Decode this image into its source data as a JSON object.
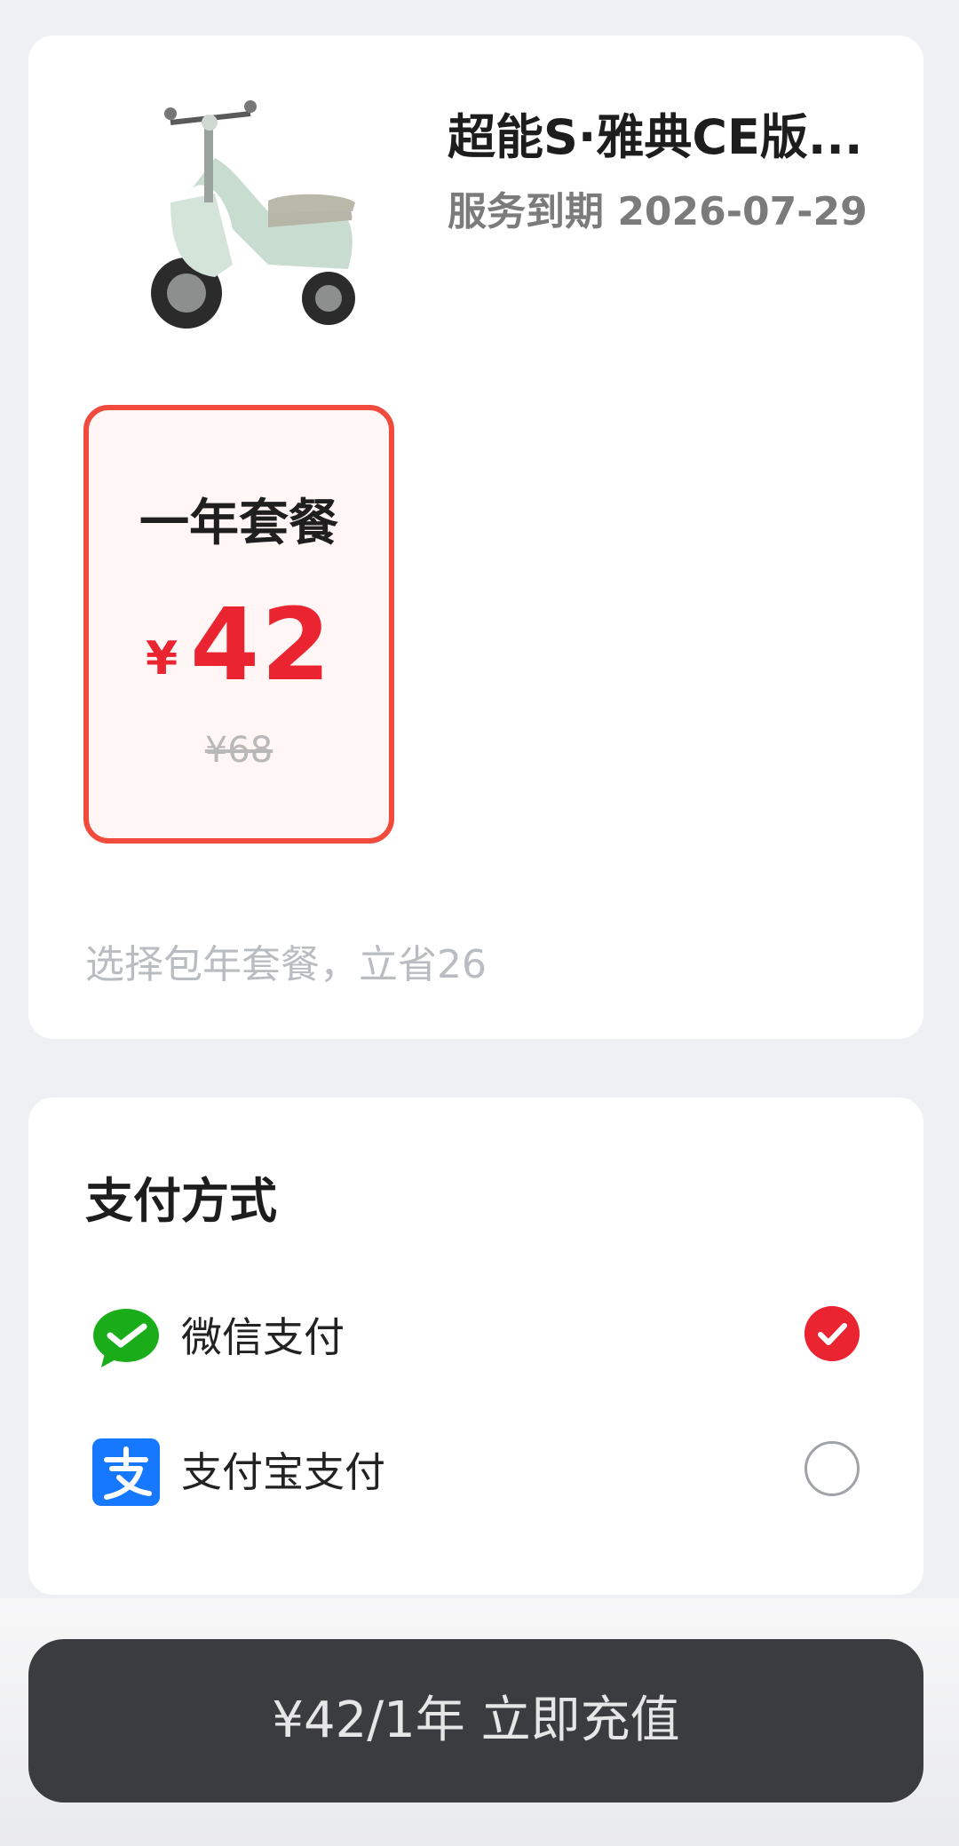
{
  "product": {
    "image_alt": "scooter",
    "title": "超能S·雅典CE版...",
    "expire_text": "服务到期 2026-07-29"
  },
  "plan": {
    "name": "一年套餐",
    "currency": "¥",
    "price": "42",
    "original_price": "¥68",
    "selected": true
  },
  "hint": "选择包年套餐，立省26",
  "payment": {
    "title": "支付方式",
    "methods": [
      {
        "label": "微信支付",
        "icon": "wechat-pay-icon",
        "selected": true
      },
      {
        "label": "支付宝支付",
        "icon": "alipay-icon",
        "selected": false
      }
    ]
  },
  "cta": {
    "label": "¥42/1年 立即充值"
  },
  "colors": {
    "accent": "#ea2430",
    "plan_border": "#f04b3c",
    "wechat": "#1aad19",
    "alipay": "#1677ff",
    "button": "#3b3c3f"
  }
}
